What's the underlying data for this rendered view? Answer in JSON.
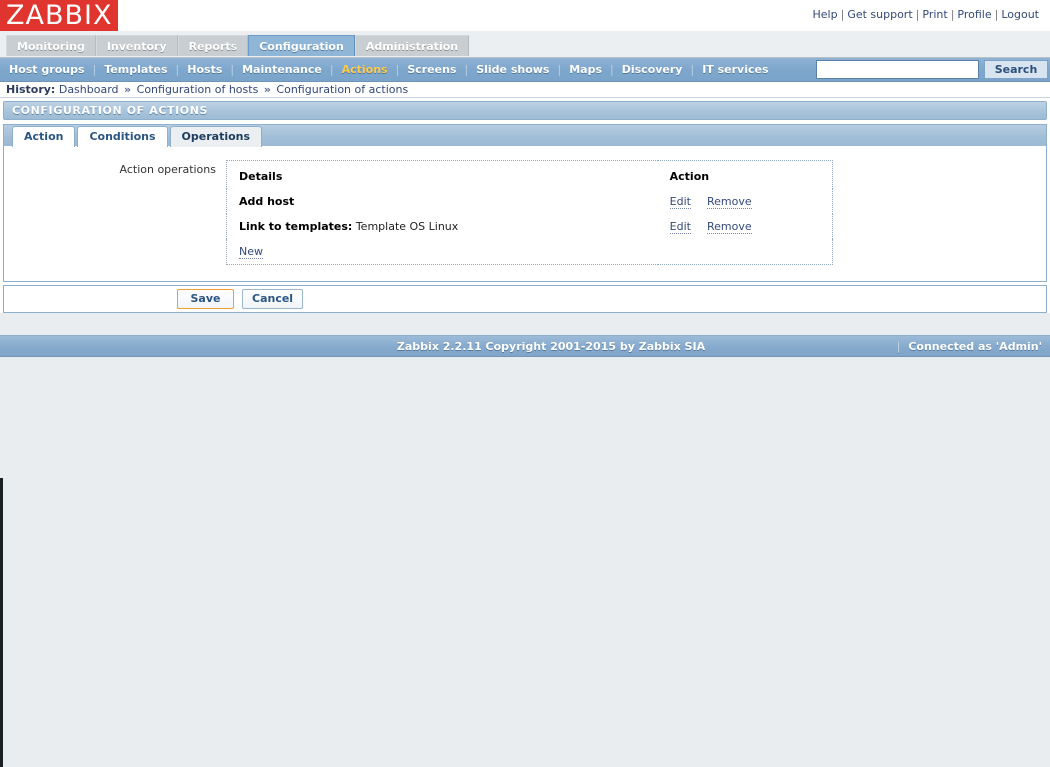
{
  "header": {
    "logo_text": "ZABBIX",
    "top_links": [
      {
        "label": "Help"
      },
      {
        "label": "Get support"
      },
      {
        "label": "Print"
      },
      {
        "label": "Profile"
      },
      {
        "label": "Logout"
      }
    ],
    "separator": "|"
  },
  "main_menu": {
    "items": [
      {
        "label": "Monitoring",
        "selected": false
      },
      {
        "label": "Inventory",
        "selected": false
      },
      {
        "label": "Reports",
        "selected": false
      },
      {
        "label": "Configuration",
        "selected": true
      },
      {
        "label": "Administration",
        "selected": false
      }
    ]
  },
  "sub_menu": {
    "items": [
      {
        "label": "Host groups",
        "selected": false
      },
      {
        "label": "Templates",
        "selected": false
      },
      {
        "label": "Hosts",
        "selected": false
      },
      {
        "label": "Maintenance",
        "selected": false
      },
      {
        "label": "Actions",
        "selected": true
      },
      {
        "label": "Screens",
        "selected": false
      },
      {
        "label": "Slide shows",
        "selected": false
      },
      {
        "label": "Maps",
        "selected": false
      },
      {
        "label": "Discovery",
        "selected": false
      },
      {
        "label": "IT services",
        "selected": false
      }
    ],
    "separator": "|"
  },
  "search": {
    "value": "",
    "placeholder": "",
    "button_label": "Search"
  },
  "history": {
    "label": "History:",
    "separator": "»",
    "items": [
      {
        "label": "Dashboard"
      },
      {
        "label": "Configuration of hosts"
      },
      {
        "label": "Configuration of actions"
      }
    ]
  },
  "page_title": "CONFIGURATION OF ACTIONS",
  "tabs": [
    {
      "label": "Action",
      "active": false
    },
    {
      "label": "Conditions",
      "active": false
    },
    {
      "label": "Operations",
      "active": true
    }
  ],
  "form": {
    "operations_label": "Action operations",
    "table": {
      "headers": {
        "details": "Details",
        "action": "Action"
      },
      "rows": [
        {
          "details_label": "Add host",
          "details_value": "",
          "edit_label": "Edit",
          "remove_label": "Remove"
        },
        {
          "details_label": "Link to templates:",
          "details_value": "Template OS Linux",
          "edit_label": "Edit",
          "remove_label": "Remove"
        }
      ],
      "new_label": "New"
    }
  },
  "buttons": {
    "save_label": "Save",
    "cancel_label": "Cancel"
  },
  "footer": {
    "copyright": "Zabbix 2.2.11 Copyright 2001-2015 by Zabbix SIA",
    "separator": "|",
    "connected_as": "Connected as 'Admin'"
  },
  "colors": {
    "brand_red": "#e0342f",
    "accent_blue": "#8fb6d7",
    "selected_submenu": "#ffcb4d",
    "focus_orange": "#f0a030",
    "link_blue": "#33497a"
  }
}
